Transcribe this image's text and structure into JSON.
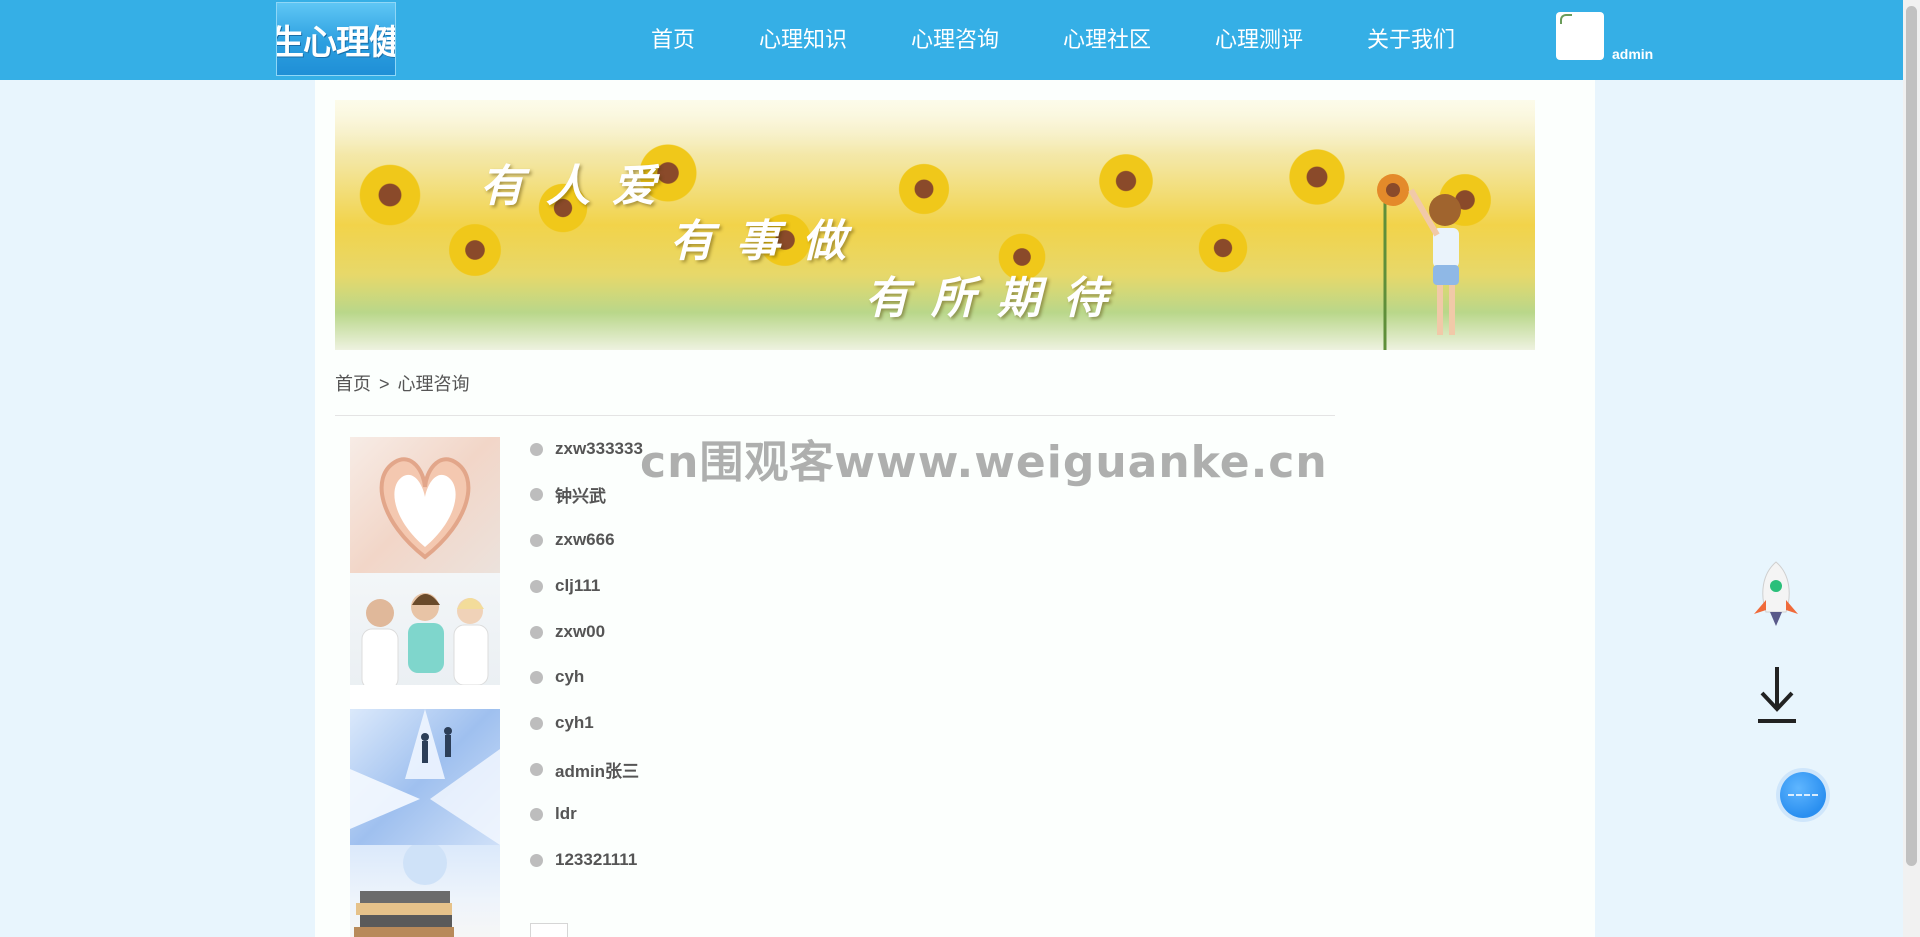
{
  "header": {
    "logo_text": "学生心理健康",
    "nav": [
      {
        "label": "首页"
      },
      {
        "label": "心理知识"
      },
      {
        "label": "心理咨询"
      },
      {
        "label": "心理社区"
      },
      {
        "label": "心理测评"
      },
      {
        "label": "关于我们"
      }
    ],
    "user": {
      "name": "admin"
    }
  },
  "banner": {
    "slogans": [
      "有人爱",
      "有事做",
      "有所期待"
    ]
  },
  "breadcrumb": {
    "home": "首页",
    "separator": ">",
    "current": "心理咨询"
  },
  "consult_list": [
    {
      "name": "zxw333333"
    },
    {
      "name": "钟兴武"
    },
    {
      "name": "zxw666"
    },
    {
      "name": "clj111"
    },
    {
      "name": "zxw00"
    },
    {
      "name": "cyh"
    },
    {
      "name": "cyh1"
    },
    {
      "name": "admin张三"
    },
    {
      "name": "ldr"
    },
    {
      "name": "123321111"
    }
  ],
  "watermark": "cn围观客www.weiguanke.cn",
  "colors": {
    "header_bg": "#35afe6",
    "page_bg": "#e8f5fd",
    "bullet": "#bdbdbd",
    "text": "#555555"
  }
}
